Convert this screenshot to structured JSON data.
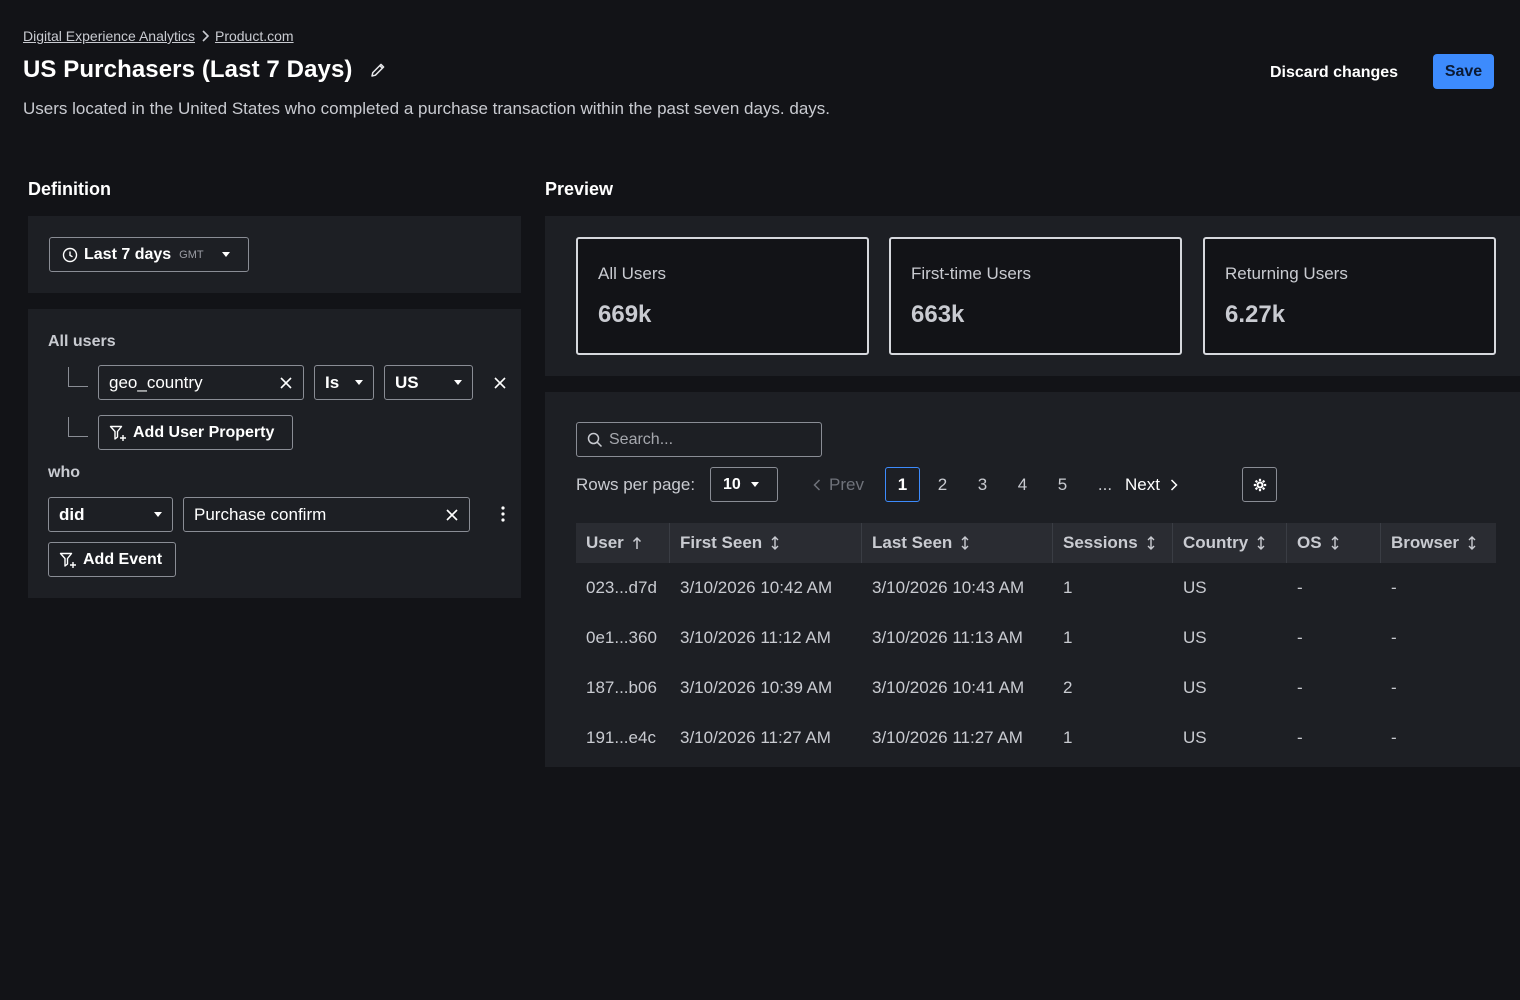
{
  "breadcrumb": {
    "root": "Digital Experience Analytics",
    "current": "Product.com"
  },
  "header": {
    "title": "US Purchasers (Last 7 Days)",
    "description": "Users located in the United States who completed a purchase transaction within the past seven days. days.",
    "discard_label": "Discard changes",
    "save_label": "Save"
  },
  "definition": {
    "heading": "Definition",
    "date_range": {
      "label": "Last 7 days",
      "timezone": "GMT"
    },
    "users_label": "All users",
    "property_filter": {
      "property": "geo_country",
      "operator": "Is",
      "value": "US"
    },
    "add_property_label": "Add User Property",
    "who_label": "who",
    "event_filter": {
      "verb": "did",
      "event": "Purchase confirm"
    },
    "add_event_label": "Add Event"
  },
  "preview": {
    "heading": "Preview",
    "metrics": [
      {
        "label": "All Users",
        "value": "669k"
      },
      {
        "label": "First-time Users",
        "value": "663k"
      },
      {
        "label": "Returning Users",
        "value": "6.27k"
      }
    ],
    "search_placeholder": "Search...",
    "rows_per_page_label": "Rows per page:",
    "rows_per_page": "10",
    "pagination": {
      "prev": "Prev",
      "pages": [
        "1",
        "2",
        "3",
        "4",
        "5"
      ],
      "active": "1",
      "ellipsis": "...",
      "next": "Next"
    },
    "table": {
      "columns": [
        "User",
        "First Seen",
        "Last Seen",
        "Sessions",
        "Country",
        "OS",
        "Browser"
      ],
      "rows": [
        [
          "023...d7d",
          "3/10/2026 10:42 AM",
          "3/10/2026 10:43 AM",
          "1",
          "US",
          "-",
          "-"
        ],
        [
          "0e1...360",
          "3/10/2026 11:12 AM",
          "3/10/2026 11:13 AM",
          "1",
          "US",
          "-",
          "-"
        ],
        [
          "187...b06",
          "3/10/2026 10:39 AM",
          "3/10/2026 10:41 AM",
          "2",
          "US",
          "-",
          "-"
        ],
        [
          "191...e4c",
          "3/10/2026 11:27 AM",
          "3/10/2026 11:27 AM",
          "1",
          "US",
          "-",
          "-"
        ]
      ]
    }
  },
  "colors": {
    "background": "#121317",
    "panel": "#1d1f24",
    "accent": "#3d8bfd"
  }
}
